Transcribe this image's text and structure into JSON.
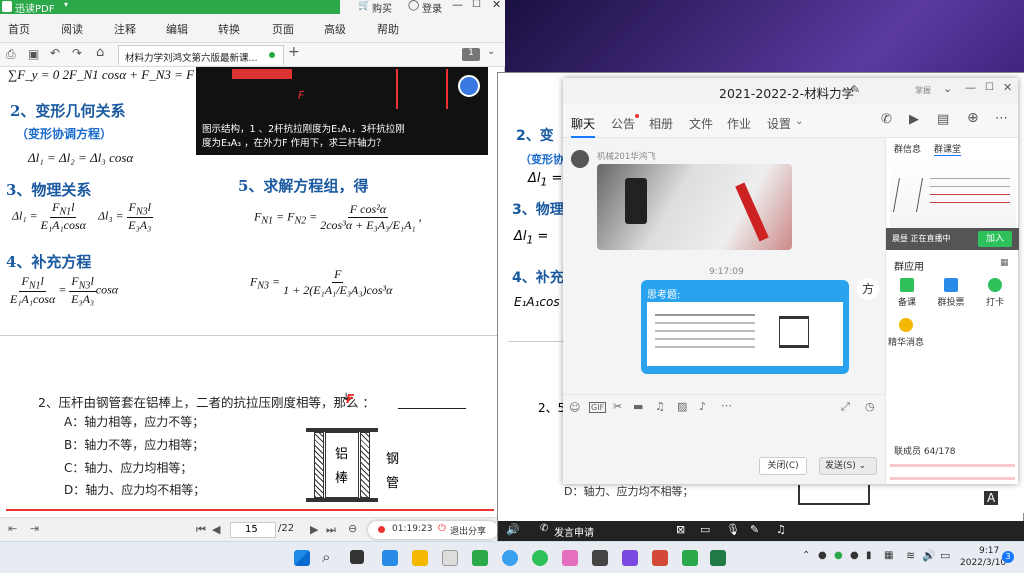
{
  "pdf": {
    "app_name": "迅读PDF",
    "buy": "购买",
    "login": "登录",
    "menu": [
      "首页",
      "阅读",
      "注释",
      "编辑",
      "转换",
      "页面",
      "高级",
      "帮助"
    ],
    "doc_tab": "材料力学刘鸿文第六版最新课...",
    "page_badge": "1",
    "current_page": "15",
    "total_pages": "/22",
    "record_time": "01:19:23",
    "exit_share": "退出分享"
  },
  "slide": {
    "top_eq": "∑F_y = 0   2F_N1 cosα + F_N3 = F",
    "h2": "2、变形几何关系",
    "h2_sub": "（变形协调方程）",
    "eq2": "Δl₁ = Δl₂ = Δl₃ cosα",
    "h3": "3、物理关系",
    "h4": "4、补充方程",
    "h5": "5、求解方程组，得",
    "video_text1": "图示结构，1 、2杆抗拉刚度为E₁A₁，3杆抗拉刚",
    "video_text2": "度为E₃A₃ ，在外力F 作用下，求三杆轴力？",
    "q_title": "2、压杆由钢管套在铝棒上，二者的抗拉压刚度相等，那么 ：",
    "q_a": "A：轴力相等，应力不等；",
    "q_b": "B：轴力不等，应力相等；",
    "q_c": "C：轴力、应力均相等；",
    "q_d": "D：轴力、应力均不相等；",
    "fig_F": "F",
    "fig_al": "铝",
    "fig_bang": "棒",
    "fig_gang": "钢",
    "fig_guan": "管"
  },
  "chat": {
    "title": "2021-2022-2-材料力学",
    "tabs": [
      "聊天",
      "公告",
      "相册",
      "文件",
      "作业",
      "设置"
    ],
    "sender": "机械201华鸿飞",
    "time": "9:17:09",
    "thinking": "思考题:",
    "close_btn": "关闭(C)",
    "send_btn": "发送(S)",
    "side_tabs": [
      "群信息",
      "群课堂"
    ],
    "live_status": "晨昼 正在直播中",
    "join_btn": "加入",
    "group_app": "群应用",
    "apps": [
      "备课",
      "群投票",
      "打卡",
      "精华消息"
    ],
    "member_count": "联成员 64/178"
  },
  "meet": {
    "speak": "发言申请",
    "label_A": "A"
  },
  "taskbar": {
    "time": "9:17",
    "date": "2022/3/10",
    "badge": "3"
  }
}
